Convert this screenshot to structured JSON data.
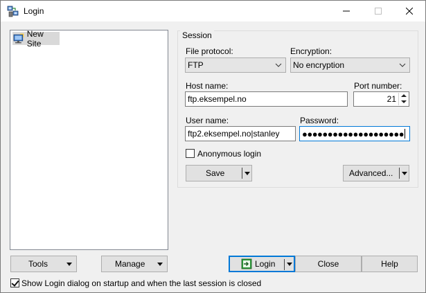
{
  "window": {
    "title": "Login",
    "minimize_glyph": "—",
    "maximize_glyph": "☐",
    "close_glyph": "✕"
  },
  "site_tree": {
    "items": [
      {
        "label": "New Site",
        "icon": "computer-icon",
        "selected": true
      }
    ]
  },
  "session": {
    "legend": "Session",
    "file_protocol": {
      "label": "File protocol:",
      "value": "FTP"
    },
    "encryption": {
      "label": "Encryption:",
      "value": "No encryption"
    },
    "host_name": {
      "label": "Host name:",
      "value": "ftp.eksempel.no"
    },
    "port_number": {
      "label": "Port number:",
      "value": "21"
    },
    "user_name": {
      "label": "User name:",
      "value": "ftp2.eksempel.no|stanley"
    },
    "password": {
      "label": "Password:",
      "masked_value": "●●●●●●●●●●●●●●●●●●●●"
    },
    "anonymous_login": {
      "label": "Anonymous login",
      "checked": false
    },
    "save_label": "Save",
    "advanced_label": "Advanced..."
  },
  "bottom": {
    "tools_label": "Tools",
    "manage_label": "Manage",
    "login_label": "Login",
    "close_label": "Close",
    "help_label": "Help",
    "show_on_startup": {
      "label": "Show Login dialog on startup and when the last session is closed",
      "checked": true
    }
  },
  "colors": {
    "accent": "#0078d7",
    "login_icon_green": "#2e9a3a"
  }
}
